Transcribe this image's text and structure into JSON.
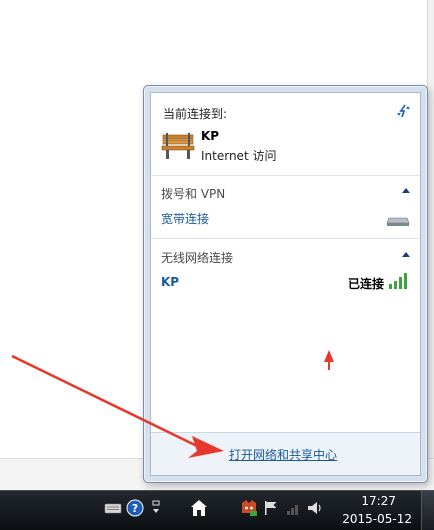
{
  "popup": {
    "current_label": "当前连接到:",
    "current": {
      "name": "KP",
      "access": "Internet 访问"
    },
    "sections": {
      "dialup": {
        "title": "拨号和 VPN",
        "item": "宽带连接"
      },
      "wireless": {
        "title": "无线网络连接",
        "network": "KP",
        "status": "已连接"
      }
    },
    "footer_link": "打开网络和共享中心"
  },
  "taskbar": {
    "time": "17:27",
    "date": "2015-05-12"
  },
  "colors": {
    "link": "#1a5a9c",
    "arrow": "#e8372c",
    "signal": "#3aa53a"
  },
  "icons": [
    "refresh-icon",
    "bench-network-icon",
    "modem-icon",
    "signal-bars-icon",
    "keyboard-icon",
    "help-icon",
    "network-tray-icon",
    "action-center-flag-icon",
    "volume-icon"
  ]
}
